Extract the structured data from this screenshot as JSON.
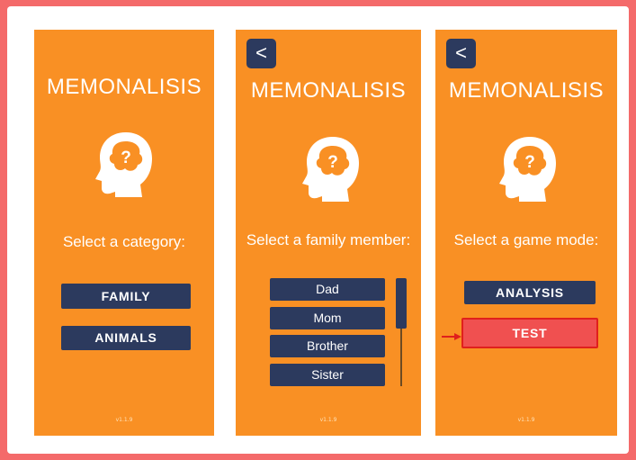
{
  "app_title": "MEMONALISIS",
  "back_label": "<",
  "version": "v1.1.9",
  "screens": [
    {
      "prompt": "Select a category:",
      "buttons": [
        "FAMILY",
        "ANIMALS"
      ]
    },
    {
      "prompt": "Select a family member:",
      "members": [
        "Dad",
        "Mom",
        "Brother",
        "Sister"
      ]
    },
    {
      "prompt": "Select a game mode:",
      "buttons": [
        "ANALYSIS",
        "TEST"
      ]
    }
  ],
  "colors": {
    "outer_border": "#f46a6a",
    "screen_bg": "#f99024",
    "button": "#2c3a5e",
    "highlight": "#f05050",
    "highlight_border": "#e0201c"
  },
  "icons": [
    "head-question-icon",
    "back-arrow-icon",
    "red-arrow-icon"
  ]
}
